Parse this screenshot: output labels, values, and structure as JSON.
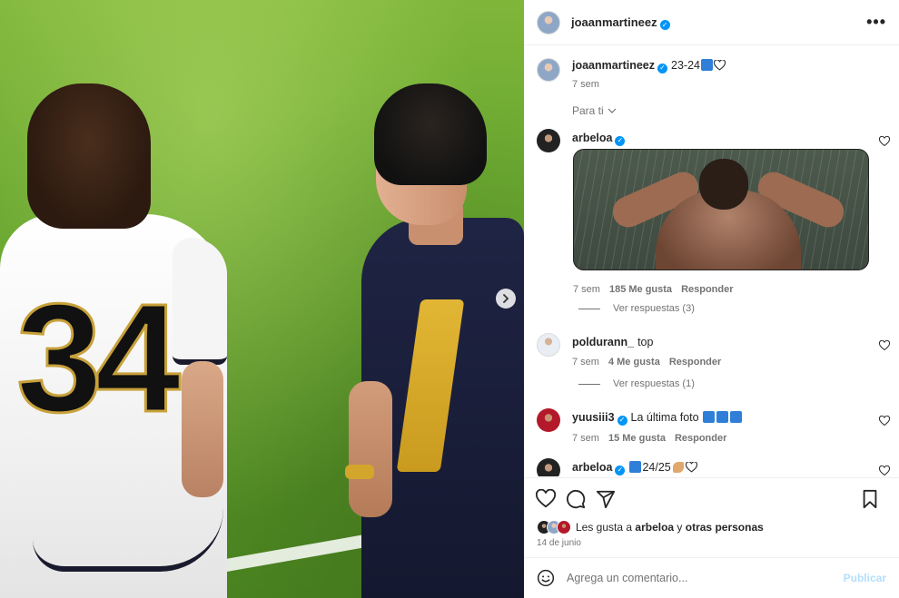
{
  "post": {
    "username": "joaanmartineez",
    "more_label": "•••",
    "caption": "23-24",
    "caption_time": "7 sem",
    "sort_label": "Para ti",
    "accent_color": "#0095f6"
  },
  "media": {
    "jersey_number": "34",
    "next_icon": "chevron-right-icon"
  },
  "comments": [
    {
      "username": "arbeloa",
      "verified": true,
      "time": "7 sem",
      "likes": "185 Me gusta",
      "reply": "Responder",
      "view_replies": "Ver respuestas (3)"
    },
    {
      "username": "poldurann_",
      "text": "top",
      "time": "7 sem",
      "likes": "4 Me gusta",
      "reply": "Responder",
      "view_replies": "Ver respuestas (1)"
    },
    {
      "username": "yuusiii3",
      "verified": true,
      "text": "La última foto",
      "time": "7 sem",
      "likes": "15 Me gusta",
      "reply": "Responder"
    },
    {
      "username": "arbeloa",
      "verified": true,
      "text": "24/25"
    }
  ],
  "actions": {
    "likes_prefix": "Les gusta a",
    "likes_user": "arbeloa",
    "likes_connector": "y",
    "likes_others": "otras personas",
    "date": "14 de junio"
  },
  "composer": {
    "placeholder": "Agrega un comentario...",
    "publish_label": "Publicar"
  }
}
